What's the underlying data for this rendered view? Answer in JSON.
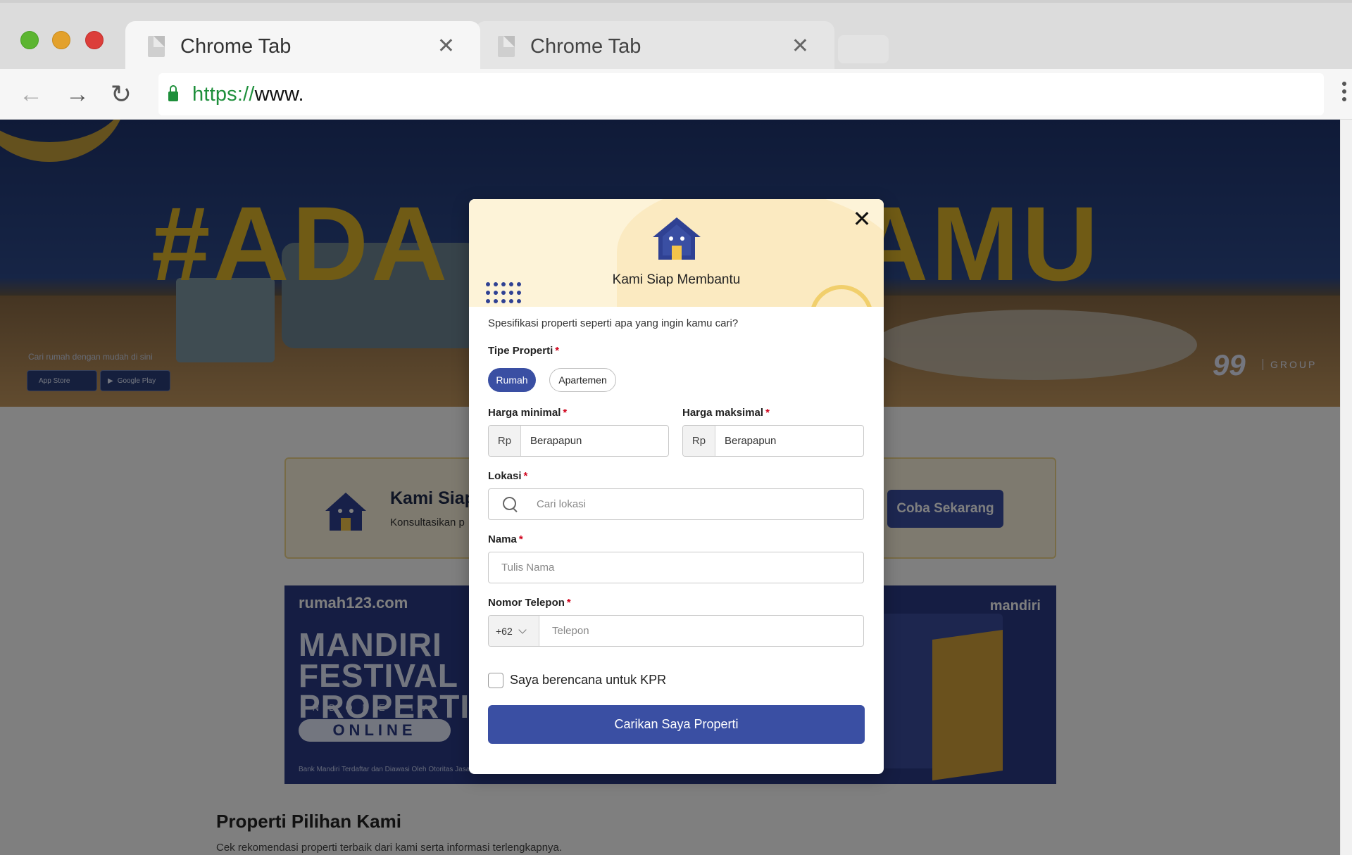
{
  "browser": {
    "tabs": [
      {
        "title": "Chrome Tab",
        "active": true
      },
      {
        "title": "Chrome Tab",
        "active": false
      }
    ],
    "url": {
      "scheme": "https://",
      "rest": "www."
    }
  },
  "hero": {
    "headline_left": "#ADA",
    "headline_right": "AMU",
    "caption": "Cari rumah dengan mudah di sini",
    "app_store": "App Store",
    "google_play": "Google Play",
    "brand_number": "99",
    "brand_group": "GROUP"
  },
  "promo": {
    "title": "Kami Siap",
    "subtitle": "Konsultasikan p",
    "button": "Coba Sekarang"
  },
  "banner": {
    "brand": "rumah123.com",
    "title_line1": "MANDIRI",
    "title_line2": "FESTIVAL",
    "title_line3": "PROPERTI",
    "indonesia": "INDONESIA",
    "online": "ONLINE",
    "footnote": "Bank Mandiri Terdaftar dan Diawasi Oleh Otoritas Jasa Ke",
    "partner": "mandiri"
  },
  "section": {
    "title": "Properti Pilihan Kami",
    "subtitle": "Cek rekomendasi properti terbaik dari kami serta informasi terlengkapnya."
  },
  "modal": {
    "title": "Kami Siap Membantu",
    "question": "Spesifikasi properti seperti apa yang ingin kamu cari?",
    "required_mark": "*",
    "property_type": {
      "label": "Tipe Properti",
      "options": [
        "Rumah",
        "Apartemen"
      ],
      "selected": "Rumah"
    },
    "min_price": {
      "label": "Harga minimal",
      "prefix": "Rp",
      "placeholder": "Berapapun"
    },
    "max_price": {
      "label": "Harga maksimal",
      "prefix": "Rp",
      "placeholder": "Berapapun"
    },
    "location": {
      "label": "Lokasi",
      "placeholder": "Cari lokasi"
    },
    "name": {
      "label": "Nama",
      "placeholder": "Tulis Nama"
    },
    "phone": {
      "label": "Nomor Telepon",
      "country_code": "+62",
      "placeholder": "Telepon"
    },
    "kpr_checkbox": {
      "label": "Saya berencana untuk KPR",
      "checked": false
    },
    "submit": "Carikan Saya Properti"
  },
  "colors": {
    "primary": "#3a4fa3",
    "required": "#d0021b",
    "modal_header": "#fdf3d8",
    "accent_yellow": "#f1cf6c"
  },
  "icons": [
    "document-icon",
    "close-icon",
    "back-arrow-icon",
    "forward-arrow-icon",
    "reload-icon",
    "lock-icon",
    "more-vert-icon",
    "house-icon",
    "search-icon",
    "chevron-down-icon"
  ]
}
